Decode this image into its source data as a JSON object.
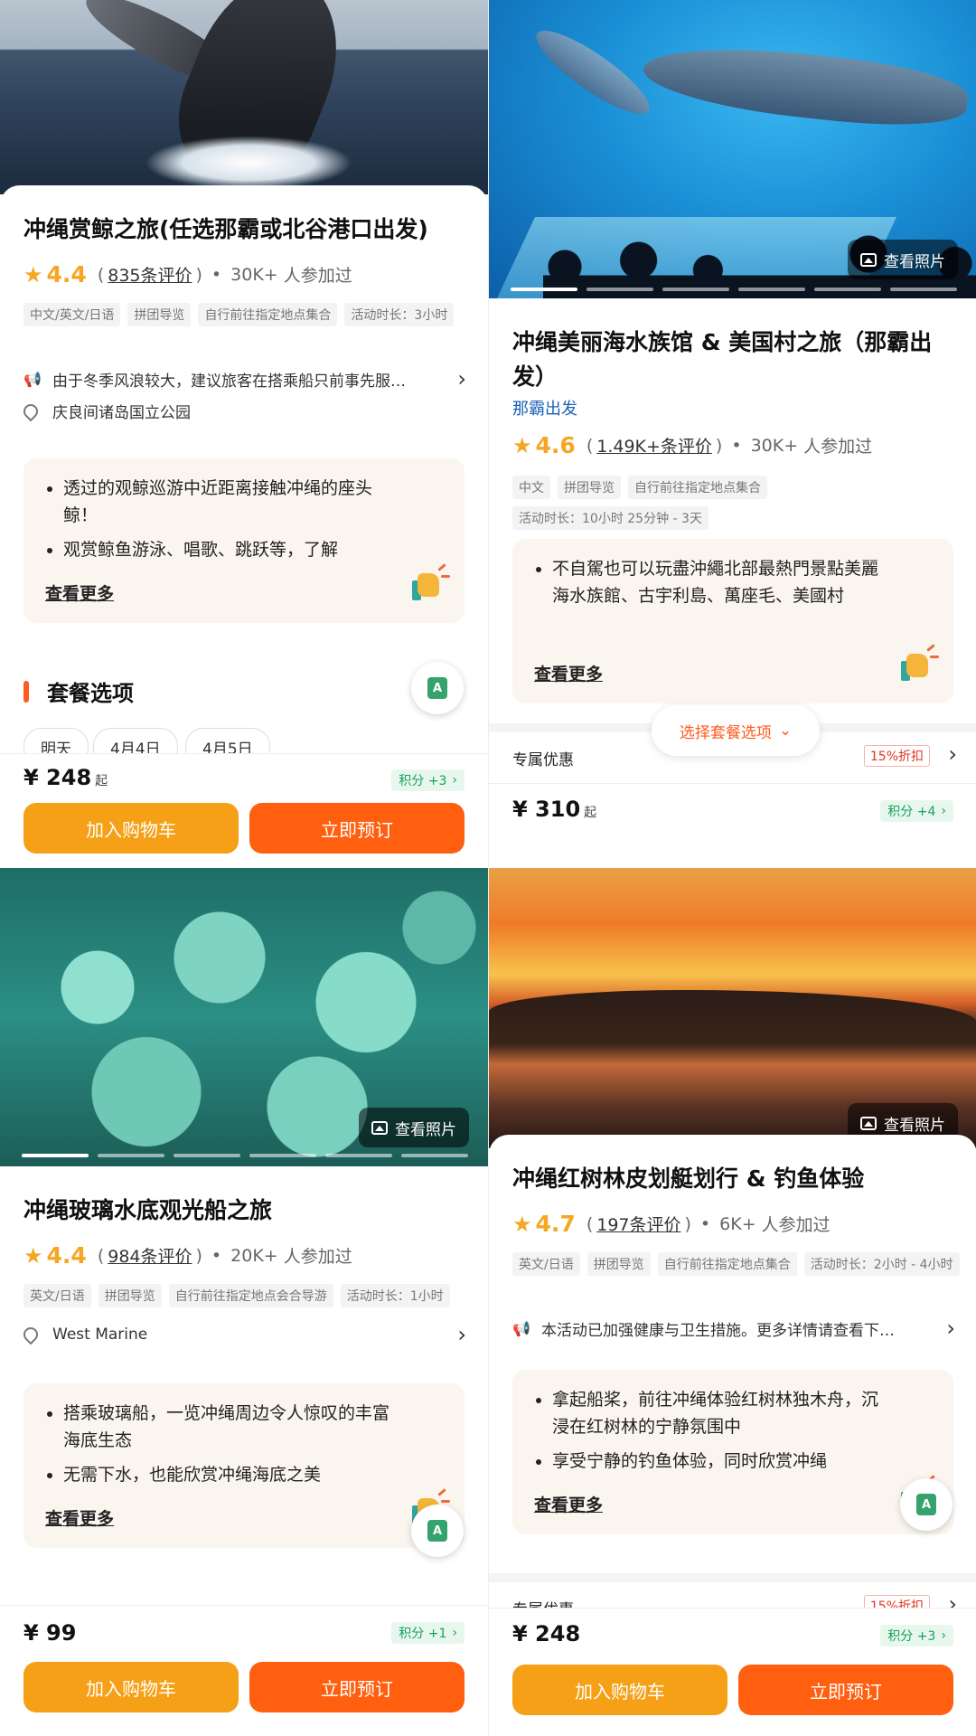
{
  "common": {
    "view_photos": "查看照片",
    "see_more": "查看更多",
    "add_cart": "加入购物车",
    "book_now": "立即预订",
    "price_suffix": "起",
    "participants_suffix": "人参加过",
    "exclusive_offer": "专属优惠",
    "discount_badge": "15%折扣",
    "translate_glyph": "A"
  },
  "cards": [
    {
      "title": "冲绳赏鲸之旅(任选那霸或北谷港口出发)",
      "rating": "4.4",
      "reviews": "835条评价",
      "participants": "30K+",
      "tags": [
        "中文/英文/日语",
        "拼团导览",
        "自行前往指定地点集合",
        "活动时长：3小时"
      ],
      "notice": "由于冬季风浪较大，建议旅客在搭乘船只前事先服…",
      "location": "庆良间诸岛国立公园",
      "highlights": [
        "透过的观鲸巡游中近距离接触冲绳的座头鲸！",
        "观赏鲸鱼游泳、唱歌、跳跃等，了解"
      ],
      "section_title": "套餐选项",
      "dates": [
        "明天",
        "4月4日",
        "4月5日"
      ],
      "price": "¥ 248",
      "points": "积分 +3"
    },
    {
      "title": "冲绳美丽海水族馆 & 美国村之旅（那霸出发）",
      "origin": "那霸出发",
      "rating": "4.6",
      "reviews": "1.49K+条评价",
      "participants": "30K+",
      "tags": [
        "中文",
        "拼团导览",
        "自行前往指定地点集合",
        "活动时长：10小时 25分钟 - 3天"
      ],
      "highlights": [
        "不自駕也可以玩盡沖繩北部最熱門景點美麗海水族館、古宇利島、萬座毛、美國村"
      ],
      "package_pill": "选择套餐选项",
      "price": "¥ 310",
      "points": "积分 +4"
    },
    {
      "title": "冲绳玻璃水底观光船之旅",
      "rating": "4.4",
      "reviews": "984条评价",
      "participants": "20K+",
      "tags": [
        "英文/日语",
        "拼团导览",
        "自行前往指定地点会合导游",
        "活动时长：1小时"
      ],
      "location": "West Marine",
      "highlights": [
        "搭乘玻璃船，一览冲绳周边令人惊叹的丰富海底生态",
        "无需下水，也能欣赏冲绳海底之美"
      ],
      "price": "¥ 99",
      "points": "积分 +1"
    },
    {
      "title": "冲绳红树林皮划艇划行 & 钓鱼体验",
      "rating": "4.7",
      "reviews": "197条评价",
      "participants": "6K+",
      "tags": [
        "英文/日语",
        "拼团导览",
        "自行前往指定地点集合",
        "活动时长：2小时 - 4小时"
      ],
      "notice": "本活动已加强健康与卫生措施。更多详情请查看下…",
      "highlights": [
        "拿起船桨，前往冲绳体验红树林独木舟，沉浸在红树林的宁静氛围中",
        "享受宁静的钓鱼体验，同时欣赏冲绳"
      ],
      "price": "¥ 248",
      "points": "积分 +3"
    }
  ]
}
